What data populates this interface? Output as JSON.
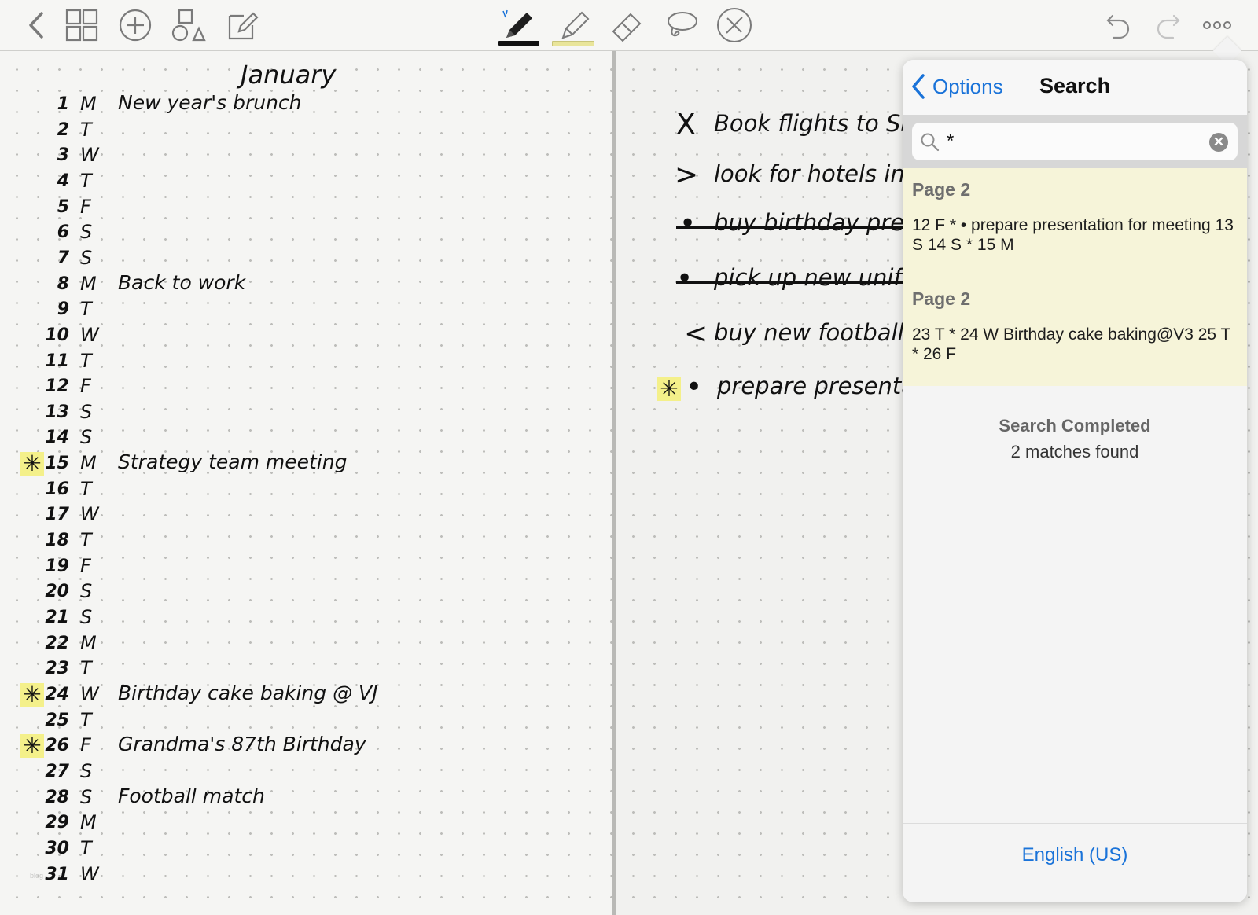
{
  "toolbar": {
    "icons": [
      "back-chevron-icon",
      "page-grid-icon",
      "add-icon",
      "shapes-icon",
      "edit-icon",
      "pen-icon",
      "highlighter-icon",
      "eraser-icon",
      "lasso-icon",
      "laser-pointer-icon",
      "undo-icon",
      "redo-icon",
      "more-icon"
    ],
    "pen_color": "#111111",
    "highlighter_color": "#e9e59a"
  },
  "left_page": {
    "title": "January",
    "rows": [
      {
        "num": "1",
        "day": "M",
        "note": "New year's brunch",
        "starred": false
      },
      {
        "num": "2",
        "day": "T",
        "note": "",
        "starred": false
      },
      {
        "num": "3",
        "day": "W",
        "note": "",
        "starred": false
      },
      {
        "num": "4",
        "day": "T",
        "note": "",
        "starred": false
      },
      {
        "num": "5",
        "day": "F",
        "note": "",
        "starred": false
      },
      {
        "num": "6",
        "day": "S",
        "note": "",
        "starred": false
      },
      {
        "num": "7",
        "day": "S",
        "note": "",
        "starred": false
      },
      {
        "num": "8",
        "day": "M",
        "note": "Back to work",
        "starred": false
      },
      {
        "num": "9",
        "day": "T",
        "note": "",
        "starred": false
      },
      {
        "num": "10",
        "day": "W",
        "note": "",
        "starred": false
      },
      {
        "num": "11",
        "day": "T",
        "note": "",
        "starred": false
      },
      {
        "num": "12",
        "day": "F",
        "note": "",
        "starred": false
      },
      {
        "num": "13",
        "day": "S",
        "note": "",
        "starred": false
      },
      {
        "num": "14",
        "day": "S",
        "note": "",
        "starred": false
      },
      {
        "num": "15",
        "day": "M",
        "note": "Strategy team meeting",
        "starred": true
      },
      {
        "num": "16",
        "day": "T",
        "note": "",
        "starred": false
      },
      {
        "num": "17",
        "day": "W",
        "note": "",
        "starred": false
      },
      {
        "num": "18",
        "day": "T",
        "note": "",
        "starred": false
      },
      {
        "num": "19",
        "day": "F",
        "note": "",
        "starred": false
      },
      {
        "num": "20",
        "day": "S",
        "note": "",
        "starred": false
      },
      {
        "num": "21",
        "day": "S",
        "note": "",
        "starred": false
      },
      {
        "num": "22",
        "day": "M",
        "note": "",
        "starred": false
      },
      {
        "num": "23",
        "day": "T",
        "note": "",
        "starred": false
      },
      {
        "num": "24",
        "day": "W",
        "note": "Birthday cake baking @ VJ",
        "starred": true
      },
      {
        "num": "25",
        "day": "T",
        "note": "",
        "starred": false
      },
      {
        "num": "26",
        "day": "F",
        "note": "Grandma's 87th Birthday",
        "starred": true
      },
      {
        "num": "27",
        "day": "S",
        "note": "",
        "starred": false
      },
      {
        "num": "28",
        "day": "S",
        "note": "Football match",
        "starred": false
      },
      {
        "num": "29",
        "day": "M",
        "note": "",
        "starred": false
      },
      {
        "num": "30",
        "day": "T",
        "note": "",
        "starred": false
      },
      {
        "num": "31",
        "day": "W",
        "note": "",
        "starred": false
      }
    ]
  },
  "right_page": {
    "tasks": [
      {
        "mark": "X",
        "text": "Book flights to SF",
        "struck": false,
        "starred": false
      },
      {
        "mark": ">",
        "text": "look for hotels in NY",
        "struck": false,
        "starred": false
      },
      {
        "mark": "•",
        "text": "buy birthday presents",
        "struck": true,
        "starred": false
      },
      {
        "mark": "•",
        "text": "pick up new uniform",
        "struck": true,
        "starred": false
      },
      {
        "mark": "<",
        "text": "buy new football",
        "struck": false,
        "starred": false
      },
      {
        "mark": "•",
        "text": "prepare presentation",
        "struck": false,
        "starred": true
      }
    ]
  },
  "search_panel": {
    "back_label": "Options",
    "title": "Search",
    "query": "*",
    "results": [
      {
        "page": "Page 2",
        "snippet": "12 F * • prepare presentation for meeting 13 S 14 S * 15 M"
      },
      {
        "page": "Page 2",
        "snippet": "23 T * 24 W Birthday cake baking@V3 25 T * 26 F"
      }
    ],
    "status_title": "Search Completed",
    "status_detail": "2 matches found",
    "language": "English (US)",
    "accent_color": "#1a73d9",
    "result_bg": "#f6f4d9"
  }
}
